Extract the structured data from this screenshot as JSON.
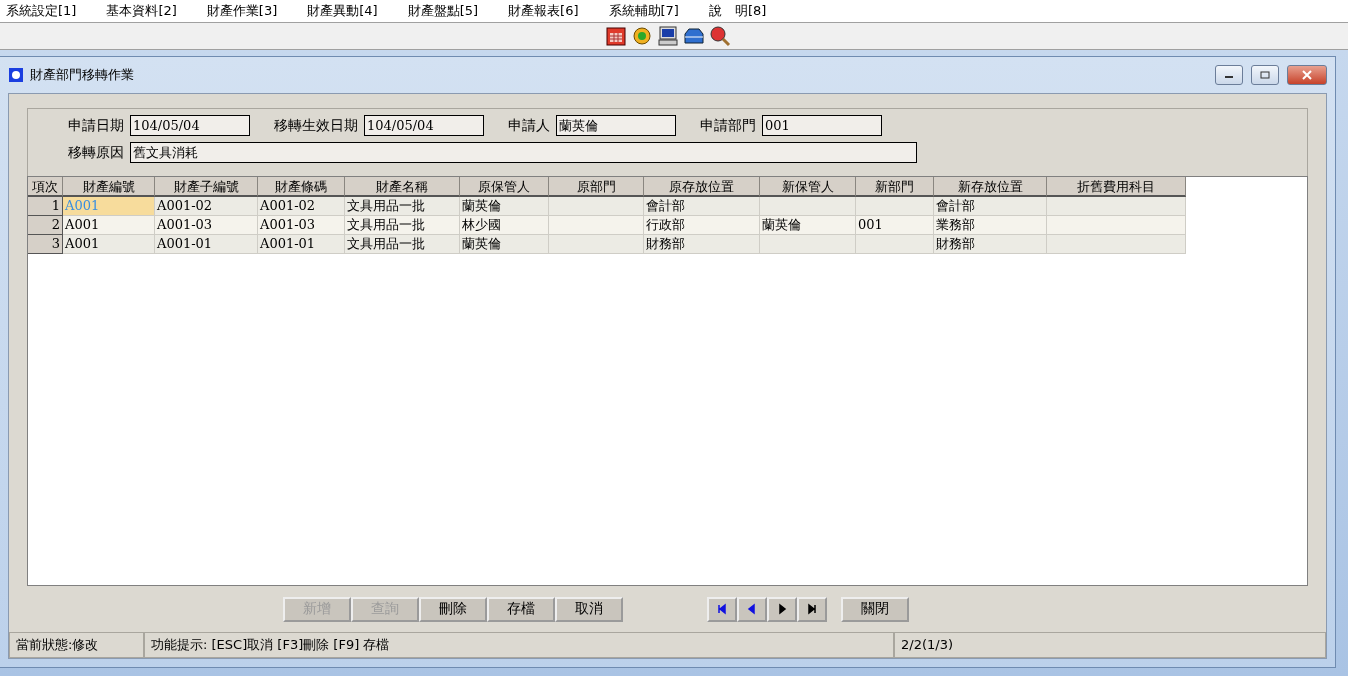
{
  "menu": [
    "系統設定[1]",
    "基本資料[2]",
    "財產作業[3]",
    "財產異動[4]",
    "財產盤點[5]",
    "財產報表[6]",
    "系統輔助[7]",
    "說　明[8]"
  ],
  "window": {
    "title": "財產部門移轉作業"
  },
  "form": {
    "row1": [
      {
        "label": "申請日期",
        "value": "104/05/04"
      },
      {
        "label": "移轉生效日期",
        "value": "104/05/04"
      },
      {
        "label": "申請人",
        "value": "蘭英倫"
      },
      {
        "label": "申請部門",
        "value": "001"
      }
    ],
    "reason": {
      "label": "移轉原因",
      "value": "舊文具消耗"
    }
  },
  "table": {
    "columns": [
      "項次",
      "財產編號",
      "財產子編號",
      "財產條碼",
      "財產名稱",
      "原保管人",
      "原部門",
      "原存放位置",
      "新保管人",
      "新部門",
      "新存放位置",
      "折舊費用科目"
    ],
    "rows": [
      {
        "selected": true,
        "cells": [
          "1",
          "A001",
          "A001-02",
          "A001-02",
          "文具用品一批",
          "蘭英倫",
          "",
          "會計部",
          "",
          "",
          "會計部",
          ""
        ]
      },
      {
        "selected": false,
        "cells": [
          "2",
          "A001",
          "A001-03",
          "A001-03",
          "文具用品一批",
          "林少國",
          "",
          "行政部",
          "蘭英倫",
          "001",
          "業務部",
          ""
        ]
      },
      {
        "selected": false,
        "cells": [
          "3",
          "A001",
          "A001-01",
          "A001-01",
          "文具用品一批",
          "蘭英倫",
          "",
          "財務部",
          "",
          "",
          "財務部",
          ""
        ]
      }
    ]
  },
  "buttons": [
    {
      "label": "新增",
      "disabled": true
    },
    {
      "label": "查詢",
      "disabled": true
    },
    {
      "label": "刪除",
      "disabled": false
    },
    {
      "label": "存檔",
      "disabled": false
    },
    {
      "label": "取消",
      "disabled": false
    }
  ],
  "nav": [
    {
      "kind": "first",
      "color": "#1010e0"
    },
    {
      "kind": "prev",
      "color": "#1010e0"
    },
    {
      "kind": "next",
      "color": "#000000"
    },
    {
      "kind": "last",
      "color": "#000000"
    }
  ],
  "close_button": "關閉",
  "status_bar": {
    "state": "當前狀態:修改",
    "hint": "功能提示: [ESC]取消 [F3]刪除 [F9] 存檔",
    "position": "2/2(1/3)"
  }
}
